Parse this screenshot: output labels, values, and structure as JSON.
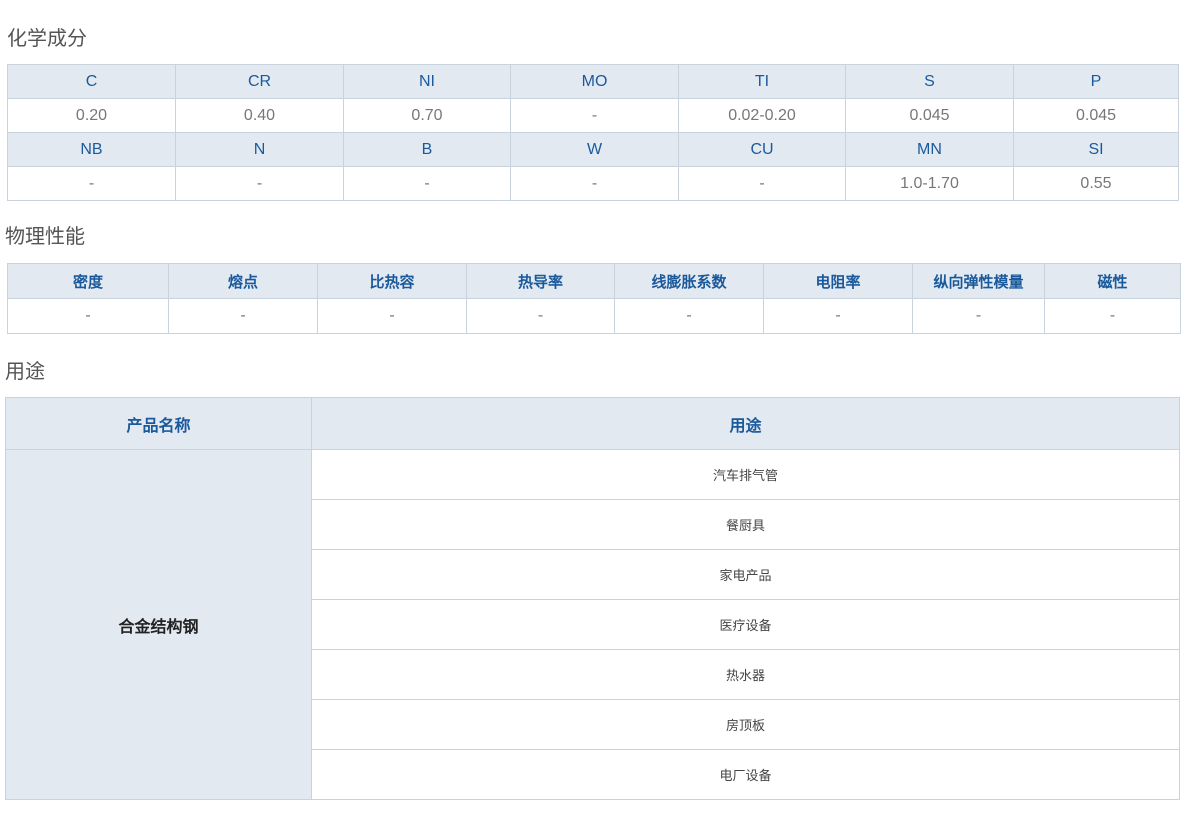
{
  "sections": {
    "chemical_title": "化学成分",
    "physical_title": "物理性能",
    "usage_title": "用途"
  },
  "chemical": {
    "row1_headers": [
      "C",
      "CR",
      "NI",
      "MO",
      "TI",
      "S",
      "P"
    ],
    "row1_values": [
      "0.20",
      "0.40",
      "0.70",
      "-",
      "0.02-0.20",
      "0.045",
      "0.045"
    ],
    "row2_headers": [
      "NB",
      "N",
      "B",
      "W",
      "CU",
      "MN",
      "SI"
    ],
    "row2_values": [
      "-",
      "-",
      "-",
      "-",
      "-",
      "1.0-1.70",
      "0.55"
    ]
  },
  "physical": {
    "headers": [
      "密度",
      "熔点",
      "比热容",
      "热导率",
      "线膨胀系数",
      "电阻率",
      "纵向弹性模量",
      "磁性"
    ],
    "values": [
      "-",
      "-",
      "-",
      "-",
      "-",
      "-",
      "-",
      "-"
    ]
  },
  "usage": {
    "header_product": "产品名称",
    "header_usage": "用途",
    "product_name": "合金结构钢",
    "uses": [
      "汽车排气管",
      "餐厨具",
      "家电产品",
      "医疗设备",
      "热水器",
      "房顶板",
      "电厂设备"
    ]
  }
}
